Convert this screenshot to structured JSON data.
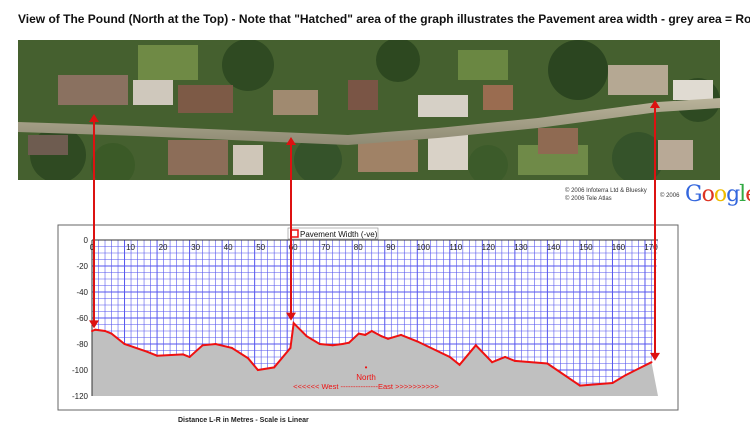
{
  "heading": "View of The Pound (North at the Top) - Note that \"Hatched\" area of the graph illustrates the Pavement area width - grey area = Road",
  "credits": {
    "line1": "© 2006 Infoterra Ltd & Bluesky",
    "line2": "© 2006 Tele Atlas",
    "line3": "© 2006",
    "logo": "Google"
  },
  "caption": "Distance L-R in Metres - Scale is Linear",
  "colors": {
    "grid": "#5555ee",
    "line": "#ee1111",
    "road": "#c0c0c0",
    "arrow": "#dd1111",
    "logo": [
      "#3366dd",
      "#dd3322",
      "#eebb00",
      "#3366dd",
      "#33aa44",
      "#dd3322"
    ]
  },
  "chart_data": {
    "type": "area",
    "title": "",
    "xlabel": "Distance L-R in Metres - Scale is Linear",
    "ylabel": "",
    "xlim": [
      0,
      174
    ],
    "ylim": [
      -120,
      0
    ],
    "x_ticks": [
      0,
      10,
      20,
      30,
      40,
      50,
      60,
      70,
      80,
      90,
      100,
      110,
      120,
      130,
      140,
      150,
      160,
      170
    ],
    "y_ticks": [
      0,
      -20,
      -40,
      -60,
      -80,
      -100,
      -120
    ],
    "grid": true,
    "legend": "top-center",
    "series": [
      {
        "name": "Pavement Width (-ve)",
        "x": [
          0,
          1,
          4,
          6,
          10,
          17,
          20,
          28,
          30,
          34,
          38,
          43,
          48,
          51,
          56,
          61,
          62,
          66,
          70,
          74,
          77,
          79,
          82,
          84,
          86,
          89,
          91,
          95,
          100,
          110,
          113,
          118,
          123,
          127,
          130,
          140,
          150,
          160,
          164,
          172
        ],
        "y": [
          -70,
          -69,
          -70,
          -72,
          -80,
          -86,
          -89,
          -88,
          -90,
          -81,
          -80,
          -83,
          -91,
          -100,
          -98,
          -83,
          -64,
          -74,
          -80,
          -81,
          -80,
          -79,
          -72,
          -73,
          -70,
          -74,
          -76,
          -73,
          -78,
          -90,
          -96,
          -81,
          -94,
          -90,
          -93,
          -95,
          -112,
          -110,
          -104,
          -94
        ]
      }
    ],
    "annotations": {
      "north_marker": "•",
      "north_label": "North",
      "direction_text": "<<<<<< West ---------------East >>>>>>>>>>"
    }
  }
}
